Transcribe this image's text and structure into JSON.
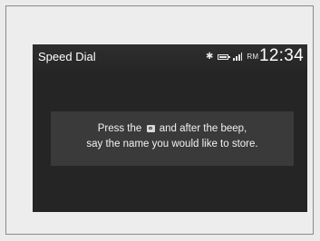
{
  "screen": {
    "title": "Speed Dial",
    "status": {
      "bluetooth_icon": "bluetooth-icon",
      "battery_icon": "battery-icon",
      "signal_icon": "signal-icon",
      "network_label": "RM",
      "clock": "12:34"
    }
  },
  "message": {
    "line1_before": "Press the",
    "icon": "talk-icon",
    "line1_after": "and after the beep,",
    "line2": "say the name you would like to store."
  }
}
